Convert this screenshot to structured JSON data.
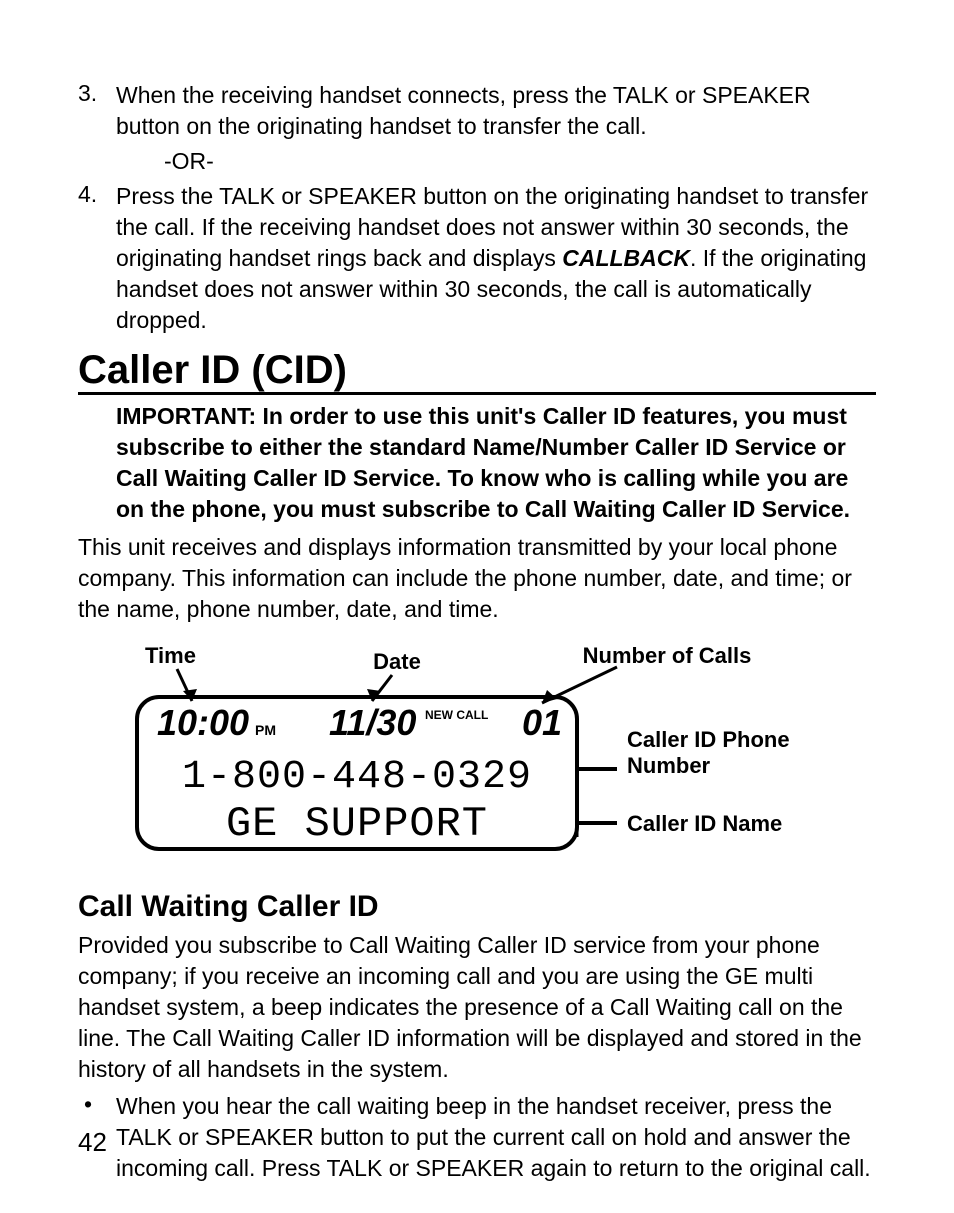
{
  "list": {
    "item3": {
      "num": "3.",
      "text": "When the receiving handset connects, press the TALK or SPEAKER button on the originating handset to transfer the call."
    },
    "or": "-OR-",
    "item4": {
      "num": "4.",
      "pre": "Press the TALK  or SPEAKER button on the originating handset to transfer the call. If the receiving handset does not answer within 30 seconds, the originating handset rings back and displays ",
      "callback": "CALLBACK",
      "post": ". If the originating handset does not answer within 30 seconds, the call is automatically dropped."
    }
  },
  "heading_cid": "Caller ID (CID)",
  "important": "IMPORTANT: In order to use this unit's Caller ID features, you must subscribe to either the standard Name/Number Caller ID Service or Call Waiting Caller ID Service. To know who is calling while you are on the phone, you must subscribe to Call Waiting Caller ID Service.",
  "cid_para": "This unit receives and displays information transmitted by your local phone company. This information can include the phone number, date, and time; or the name, phone number, date, and time.",
  "diagram": {
    "label_time": "Time",
    "label_date": "Date",
    "label_calls": "Number of Calls",
    "label_phone": "Caller ID Phone Number",
    "label_name": "Caller ID Name",
    "time": "10:00",
    "pm": "PM",
    "date": "11/30",
    "newcall": "NEW CALL",
    "count": "01",
    "phone": "1-800-448-0329",
    "name": "GE SUPPORT"
  },
  "heading_cw": "Call Waiting Caller ID",
  "cw_para": "Provided you subscribe to Call Waiting Caller ID service from your phone company; if you receive an incoming call and you are using the GE multi handset system, a beep indicates the presence of a Call Waiting call on the line. The Call Waiting Caller ID information will be displayed and stored in the history of all handsets in the system.",
  "bullet": {
    "dot": "•",
    "text": "When you hear the call waiting beep in the handset receiver, press the TALK or SPEAKER button to put the current call on hold and answer the incoming call. Press TALK or SPEAKER again to return to the original call."
  },
  "page": "42"
}
